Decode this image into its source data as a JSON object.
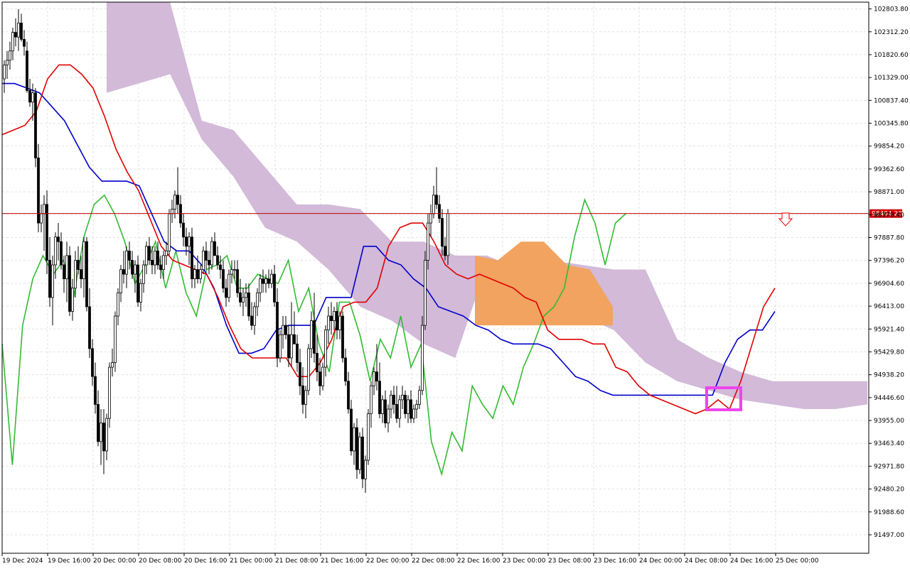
{
  "colors": {
    "background": "#ffffff",
    "grid": "#e2e2e2",
    "frame": "#000000",
    "bull_candle": "#ffffff",
    "bear_candle": "#000000",
    "tenkan_sen": "#e00000",
    "kijun_sen": "#0000cc",
    "chikou_span": "#33bb33",
    "kumo_bearish": "#d2bad8",
    "kumo_bullish": "#f1a35f",
    "price_line": "#c00000",
    "price_badge": "#d00000",
    "highlight_box": "#ee44ee",
    "sell_arrow": "#ee2222"
  },
  "icons": {
    "sell_arrow": "down-arrow-icon"
  },
  "chart_data": {
    "type": "candlestick",
    "timeframe_note": "hourly candles",
    "title": "",
    "xlabel": "",
    "ylabel": "",
    "ylim": [
      91100,
      102950
    ],
    "grid": true,
    "legend": "none",
    "current_price": 98404.2,
    "current_price_label": "98404.20",
    "y_ticks": [
      "102803.80",
      "102312.20",
      "101820.60",
      "101329.00",
      "100837.40",
      "100345.80",
      "99854.20",
      "99362.60",
      "98871.00",
      "98379.40",
      "97887.80",
      "97396.20",
      "96904.60",
      "96413.00",
      "95921.40",
      "95429.80",
      "94938.20",
      "94446.60",
      "93955.00",
      "93463.40",
      "92971.80",
      "92480.20",
      "91988.60",
      "91497.00"
    ],
    "x_ticks": [
      "19 Dec 2024",
      "19 Dec 16:00",
      "20 Dec 00:00",
      "20 Dec 08:00",
      "20 Dec 16:00",
      "21 Dec 00:00",
      "21 Dec 08:00",
      "21 Dec 16:00",
      "22 Dec 00:00",
      "22 Dec 08:00",
      "22 Dec 16:00",
      "23 Dec 00:00",
      "23 Dec 08:00",
      "23 Dec 16:00",
      "24 Dec 00:00",
      "24 Dec 08:00",
      "24 Dec 16:00",
      "25 Dec 00:00"
    ],
    "x_tick_index": [
      0,
      16,
      32,
      48,
      64,
      80,
      96,
      112,
      128,
      144,
      160,
      176,
      192,
      208,
      224,
      240,
      256,
      272
    ],
    "candles_ohlc": [
      [
        101300,
        101700,
        101000,
        101600
      ],
      [
        101600,
        101900,
        101300,
        101700
      ],
      [
        101700,
        102100,
        101500,
        101900
      ],
      [
        101900,
        102400,
        101700,
        102300
      ],
      [
        102300,
        102600,
        102000,
        102200
      ],
      [
        102200,
        102800,
        101900,
        102500
      ],
      [
        102500,
        102700,
        102100,
        102150
      ],
      [
        102150,
        102350,
        101800,
        102000
      ],
      [
        101900,
        102100,
        101000,
        101050
      ],
      [
        101050,
        101300,
        100700,
        100800
      ],
      [
        100800,
        101200,
        100400,
        101000
      ],
      [
        101000,
        101100,
        99400,
        99600
      ],
      [
        99600,
        99900,
        98000,
        98200
      ],
      [
        98200,
        98600,
        98000,
        98400
      ],
      [
        98400,
        98800,
        97600,
        98600
      ],
      [
        98600,
        98900,
        97100,
        97400
      ],
      [
        97400,
        97900,
        96400,
        96600
      ],
      [
        96600,
        97500,
        96000,
        97300
      ],
      [
        97300,
        98000,
        97000,
        97900
      ],
      [
        97900,
        98200,
        97400,
        97800
      ],
      [
        97800,
        98000,
        97200,
        97300
      ],
      [
        97300,
        97500,
        96700,
        97000
      ],
      [
        97000,
        97800,
        96500,
        97500
      ],
      [
        97500,
        97700,
        96200,
        96300
      ],
      [
        96300,
        97000,
        96100,
        96800
      ],
      [
        96800,
        97600,
        96600,
        97400
      ],
      [
        97400,
        97700,
        97100,
        97200
      ],
      [
        97200,
        97500,
        96800,
        97000
      ],
      [
        97000,
        97900,
        96600,
        97800
      ],
      [
        97800,
        97900,
        96300,
        96400
      ],
      [
        96400,
        96800,
        95300,
        95500
      ],
      [
        95500,
        95700,
        94700,
        94900
      ],
      [
        94900,
        95200,
        94100,
        94300
      ],
      [
        94300,
        94600,
        93400,
        93500
      ],
      [
        93500,
        94200,
        93000,
        93900
      ],
      [
        93900,
        94200,
        92800,
        93300
      ],
      [
        93300,
        94100,
        93100,
        94000
      ],
      [
        94000,
        95200,
        93800,
        95100
      ],
      [
        95100,
        95500,
        94900,
        95200
      ],
      [
        95200,
        96300,
        95000,
        96200
      ],
      [
        96200,
        96800,
        96000,
        96700
      ],
      [
        96700,
        97300,
        96500,
        97200
      ],
      [
        97200,
        97600,
        96900,
        97100
      ],
      [
        97100,
        97700,
        96800,
        97600
      ],
      [
        97600,
        97800,
        97200,
        97400
      ],
      [
        97400,
        97600,
        97000,
        97100
      ],
      [
        97100,
        97400,
        96700,
        97300
      ],
      [
        97300,
        97500,
        96400,
        96500
      ],
      [
        96500,
        97000,
        96300,
        96900
      ],
      [
        96900,
        97400,
        96700,
        97300
      ],
      [
        97300,
        97800,
        97100,
        97700
      ],
      [
        97700,
        97900,
        97300,
        97400
      ],
      [
        97400,
        97700,
        97100,
        97300
      ],
      [
        97300,
        97700,
        97100,
        97600
      ],
      [
        97600,
        97800,
        97200,
        97300
      ],
      [
        97300,
        97500,
        97000,
        97200
      ],
      [
        97200,
        97600,
        97000,
        97500
      ],
      [
        97500,
        97800,
        97300,
        97600
      ],
      [
        97600,
        98500,
        97500,
        98400
      ],
      [
        98400,
        98700,
        98200,
        98500
      ],
      [
        98500,
        98900,
        98300,
        98800
      ],
      [
        98800,
        99400,
        98400,
        98600
      ],
      [
        98600,
        98800,
        98100,
        98200
      ],
      [
        98200,
        98400,
        97700,
        97900
      ],
      [
        97900,
        98100,
        97500,
        97700
      ],
      [
        97700,
        98000,
        97300,
        97900
      ],
      [
        97900,
        98100,
        96800,
        97000
      ],
      [
        97000,
        97300,
        96800,
        97200
      ],
      [
        97200,
        97500,
        96900,
        97000
      ],
      [
        97000,
        97300,
        96900,
        97200
      ],
      [
        97200,
        97700,
        97100,
        97600
      ],
      [
        97600,
        97800,
        97200,
        97400
      ],
      [
        97400,
        97600,
        97100,
        97300
      ],
      [
        97300,
        97900,
        97200,
        97800
      ],
      [
        97800,
        98000,
        97500,
        97500
      ],
      [
        97500,
        97700,
        97200,
        97300
      ],
      [
        97300,
        97500,
        97000,
        97200
      ],
      [
        97200,
        97400,
        96700,
        96800
      ],
      [
        96800,
        97000,
        96400,
        96600
      ],
      [
        96600,
        97200,
        96500,
        97100
      ],
      [
        97100,
        97400,
        96900,
        97200
      ],
      [
        97200,
        97400,
        97000,
        97200
      ],
      [
        97200,
        97400,
        96600,
        96700
      ],
      [
        96700,
        97000,
        96400,
        96500
      ],
      [
        96500,
        96800,
        96200,
        96600
      ],
      [
        96600,
        96900,
        96400,
        96700
      ],
      [
        96700,
        96900,
        96100,
        96200
      ],
      [
        96200,
        96500,
        95900,
        96000
      ],
      [
        96000,
        96500,
        95800,
        96400
      ],
      [
        96400,
        96800,
        96200,
        96700
      ],
      [
        96700,
        97100,
        96500,
        97000
      ],
      [
        97000,
        97200,
        96700,
        96900
      ],
      [
        96900,
        97100,
        96700,
        97000
      ],
      [
        97000,
        97200,
        96800,
        96900
      ],
      [
        96900,
        97200,
        96800,
        97100
      ],
      [
        97100,
        97300,
        96400,
        96500
      ],
      [
        96500,
        96800,
        95100,
        95300
      ],
      [
        95300,
        95900,
        95200,
        95800
      ],
      [
        95800,
        96200,
        95500,
        96000
      ],
      [
        96000,
        96200,
        95700,
        95800
      ],
      [
        95800,
        96000,
        95100,
        95300
      ],
      [
        95300,
        96500,
        95100,
        95800
      ],
      [
        95800,
        96300,
        95600,
        95600
      ],
      [
        95600,
        95800,
        95000,
        95200
      ],
      [
        95200,
        95500,
        94500,
        94700
      ],
      [
        94700,
        95100,
        94100,
        94300
      ],
      [
        94300,
        94700,
        94000,
        94600
      ],
      [
        94600,
        95600,
        94500,
        95500
      ],
      [
        95500,
        96300,
        95300,
        96100
      ],
      [
        96100,
        96700,
        95200,
        95400
      ],
      [
        95400,
        95800,
        94800,
        95000
      ],
      [
        95000,
        95300,
        94500,
        94700
      ],
      [
        94700,
        95200,
        94600,
        95100
      ],
      [
        95100,
        96000,
        94900,
        95900
      ],
      [
        95900,
        96400,
        95600,
        96200
      ],
      [
        96200,
        96500,
        95800,
        96100
      ],
      [
        96100,
        96400,
        95900,
        96300
      ],
      [
        96300,
        96500,
        95700,
        95900
      ],
      [
        95900,
        96300,
        95700,
        96200
      ],
      [
        96200,
        96300,
        95200,
        95300
      ],
      [
        95300,
        95500,
        94700,
        94800
      ],
      [
        94800,
        95000,
        94100,
        94200
      ],
      [
        94200,
        94400,
        93200,
        93300
      ],
      [
        93300,
        93900,
        93000,
        93800
      ],
      [
        93800,
        94000,
        92700,
        92900
      ],
      [
        92900,
        93700,
        92800,
        93600
      ],
      [
        93600,
        93800,
        92500,
        92700
      ],
      [
        92700,
        93200,
        92400,
        93100
      ],
      [
        93100,
        94200,
        93000,
        94100
      ],
      [
        94100,
        94800,
        93800,
        94700
      ],
      [
        94700,
        95100,
        94500,
        95000
      ],
      [
        95000,
        95600,
        94600,
        94800
      ],
      [
        94800,
        95200,
        94000,
        94100
      ],
      [
        94100,
        94500,
        93900,
        94400
      ],
      [
        94400,
        94600,
        93800,
        93900
      ],
      [
        93900,
        94300,
        93700,
        94200
      ],
      [
        94200,
        94600,
        94000,
        94500
      ],
      [
        94500,
        94700,
        94100,
        94300
      ],
      [
        94300,
        94700,
        93900,
        94000
      ],
      [
        94000,
        94500,
        93800,
        94400
      ],
      [
        94400,
        94700,
        94200,
        94500
      ],
      [
        94500,
        94600,
        94000,
        94100
      ],
      [
        94100,
        94500,
        93900,
        94400
      ],
      [
        94400,
        94600,
        93900,
        94000
      ],
      [
        94000,
        94300,
        93900,
        94200
      ],
      [
        94200,
        94400,
        94000,
        94300
      ],
      [
        94300,
        94700,
        94200,
        94600
      ],
      [
        94600,
        96200,
        94500,
        96000
      ],
      [
        96000,
        97600,
        95900,
        97400
      ],
      [
        97400,
        98400,
        97200,
        98200
      ],
      [
        98200,
        98600,
        97900,
        98400
      ],
      [
        98400,
        99000,
        98300,
        98800
      ],
      [
        98800,
        99400,
        98500,
        98600
      ],
      [
        98600,
        98800,
        98200,
        98300
      ],
      [
        98300,
        98500,
        97500,
        97700
      ],
      [
        97700,
        97900,
        97400,
        97500
      ],
      [
        97500,
        98500,
        97300,
        98404
      ]
    ],
    "tenkan_sen": [
      100100,
      100200,
      100300,
      100600,
      101300,
      101600,
      101600,
      101400,
      101100,
      100500,
      99800,
      99300,
      98900,
      98300,
      97700,
      97400,
      97300,
      97200,
      97100,
      96600,
      96000,
      95500,
      95300,
      95300,
      95300,
      95300,
      94900,
      94900,
      95200,
      95700,
      96400,
      96500,
      96500,
      96800,
      97700,
      98100,
      98200,
      98200,
      97800,
      97300,
      97100,
      97000,
      97100,
      97000,
      96900,
      96800,
      96600,
      96500,
      95900,
      95700,
      95700,
      95700,
      95600,
      95600,
      95100,
      95000,
      94700,
      94500,
      94400,
      94300,
      94200,
      94100,
      94200,
      94400,
      94200,
      94800,
      95600,
      96400,
      96800
    ],
    "kijun_sen": [
      101200,
      101200,
      101100,
      101000,
      100700,
      100400,
      99900,
      99400,
      99100,
      99100,
      99100,
      99000,
      98400,
      97800,
      97600,
      97600,
      97300,
      96800,
      96000,
      95400,
      95400,
      95500,
      95900,
      96000,
      96000,
      96000,
      96600,
      96600,
      96600,
      97700,
      97700,
      97400,
      97300,
      97000,
      96800,
      96400,
      96300,
      96200,
      96000,
      95900,
      95700,
      95600,
      95600,
      95600,
      95500,
      95200,
      94900,
      94800,
      94600,
      94500,
      94500,
      94500,
      94500,
      94500,
      94500,
      94500,
      94500,
      94500,
      95200,
      95700,
      95900,
      95900,
      96300
    ],
    "chikou_span": [
      95600,
      93000,
      96000,
      97000,
      97500,
      97100,
      97400,
      96600,
      97900,
      98600,
      98800,
      98400,
      97800,
      96900,
      97300,
      97800,
      96800,
      97600,
      96700,
      96200,
      97200,
      97300,
      97500,
      96800,
      96800,
      97100,
      97000,
      96900,
      97400,
      96300,
      96800,
      95600,
      95000,
      96500,
      96500,
      95800,
      94800,
      95700,
      95300,
      96200,
      95100,
      95600,
      93500,
      92800,
      93700,
      93300,
      94700,
      94300,
      94000,
      94700,
      94300,
      95100,
      95600,
      96200,
      96400,
      96800,
      97900,
      98700,
      98200,
      97300,
      98200,
      98400
    ],
    "kumo_bearish_band": {
      "upper": [
        102950,
        102950,
        102950,
        100400,
        100200,
        99400,
        98600,
        98600,
        98500,
        97800,
        97800,
        97500,
        97500,
        97200,
        97400,
        97300,
        97200,
        97200,
        95700,
        95300,
        95000,
        94800,
        94800,
        94800,
        94800
      ],
      "lower": [
        101000,
        101200,
        101400,
        100000,
        99200,
        98100,
        97800,
        97200,
        96400,
        96100,
        95600,
        95300,
        97300,
        96900,
        96400,
        96200,
        95900,
        95200,
        94800,
        94600,
        94400,
        94300,
        94200,
        94200,
        94300
      ]
    },
    "kumo_bullish_band": {
      "upper": [
        97500,
        97400,
        97800,
        97800,
        97300,
        97200,
        96400
      ],
      "lower": [
        96000,
        96000,
        96000,
        96000,
        96000,
        96000,
        96000
      ]
    }
  }
}
